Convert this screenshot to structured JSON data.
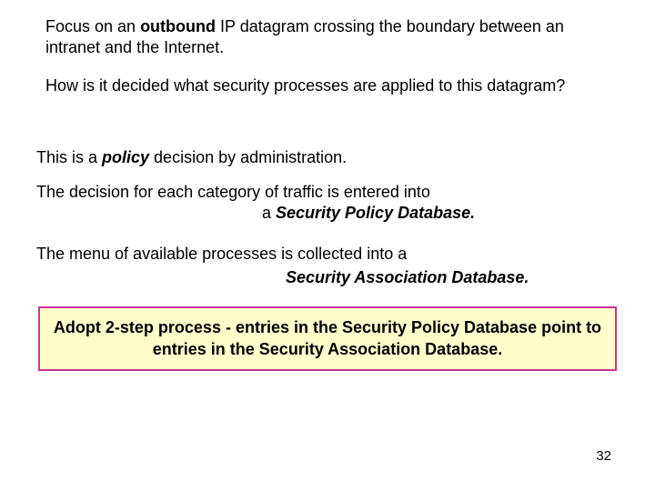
{
  "para1": {
    "pre": "Focus on an ",
    "bold": "outbound",
    "post": " IP datagram crossing the boundary between an intranet and the Internet."
  },
  "para2": "How is it decided what security processes are applied to this datagram?",
  "para3": {
    "pre": "This is a ",
    "bolditalic": "policy",
    "post": " decision by administration."
  },
  "para4": {
    "line1": "The decision for each category of traffic is entered into",
    "line2_pre": "a ",
    "line2_bolditalic": "Security Policy Database."
  },
  "para5": "The menu of available processes is collected into a",
  "para5_subline": "Security Association Database.",
  "highlight": "Adopt 2-step process - entries in the Security Policy Database point to entries in the Security Association Database.",
  "page_number": "32"
}
